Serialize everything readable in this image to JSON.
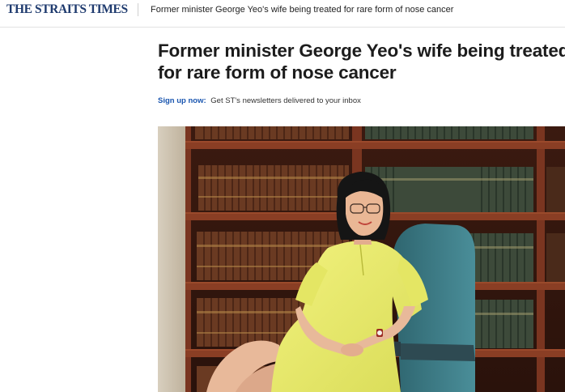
{
  "header": {
    "logo_text": "THE STRAITS TIMES",
    "article_title": "Former minister George Yeo's wife being treated for rare form of nose cancer"
  },
  "article": {
    "headline_line1": "Former minister George Yeo's wife being treated",
    "headline_line2": "for rare form of nose cancer",
    "newsletter_cta": "Sign up now:",
    "newsletter_text": "Get ST's newsletters delivered to your inbox",
    "photo_subject": "woman-in-yellow-dress-seated-before-bookshelves"
  },
  "colors": {
    "logo": "#1e3a6e",
    "cta": "#1a56b0",
    "dress": "#e9ec6a",
    "shelf": "#6e2f1c",
    "chair": "#3a7a86"
  }
}
